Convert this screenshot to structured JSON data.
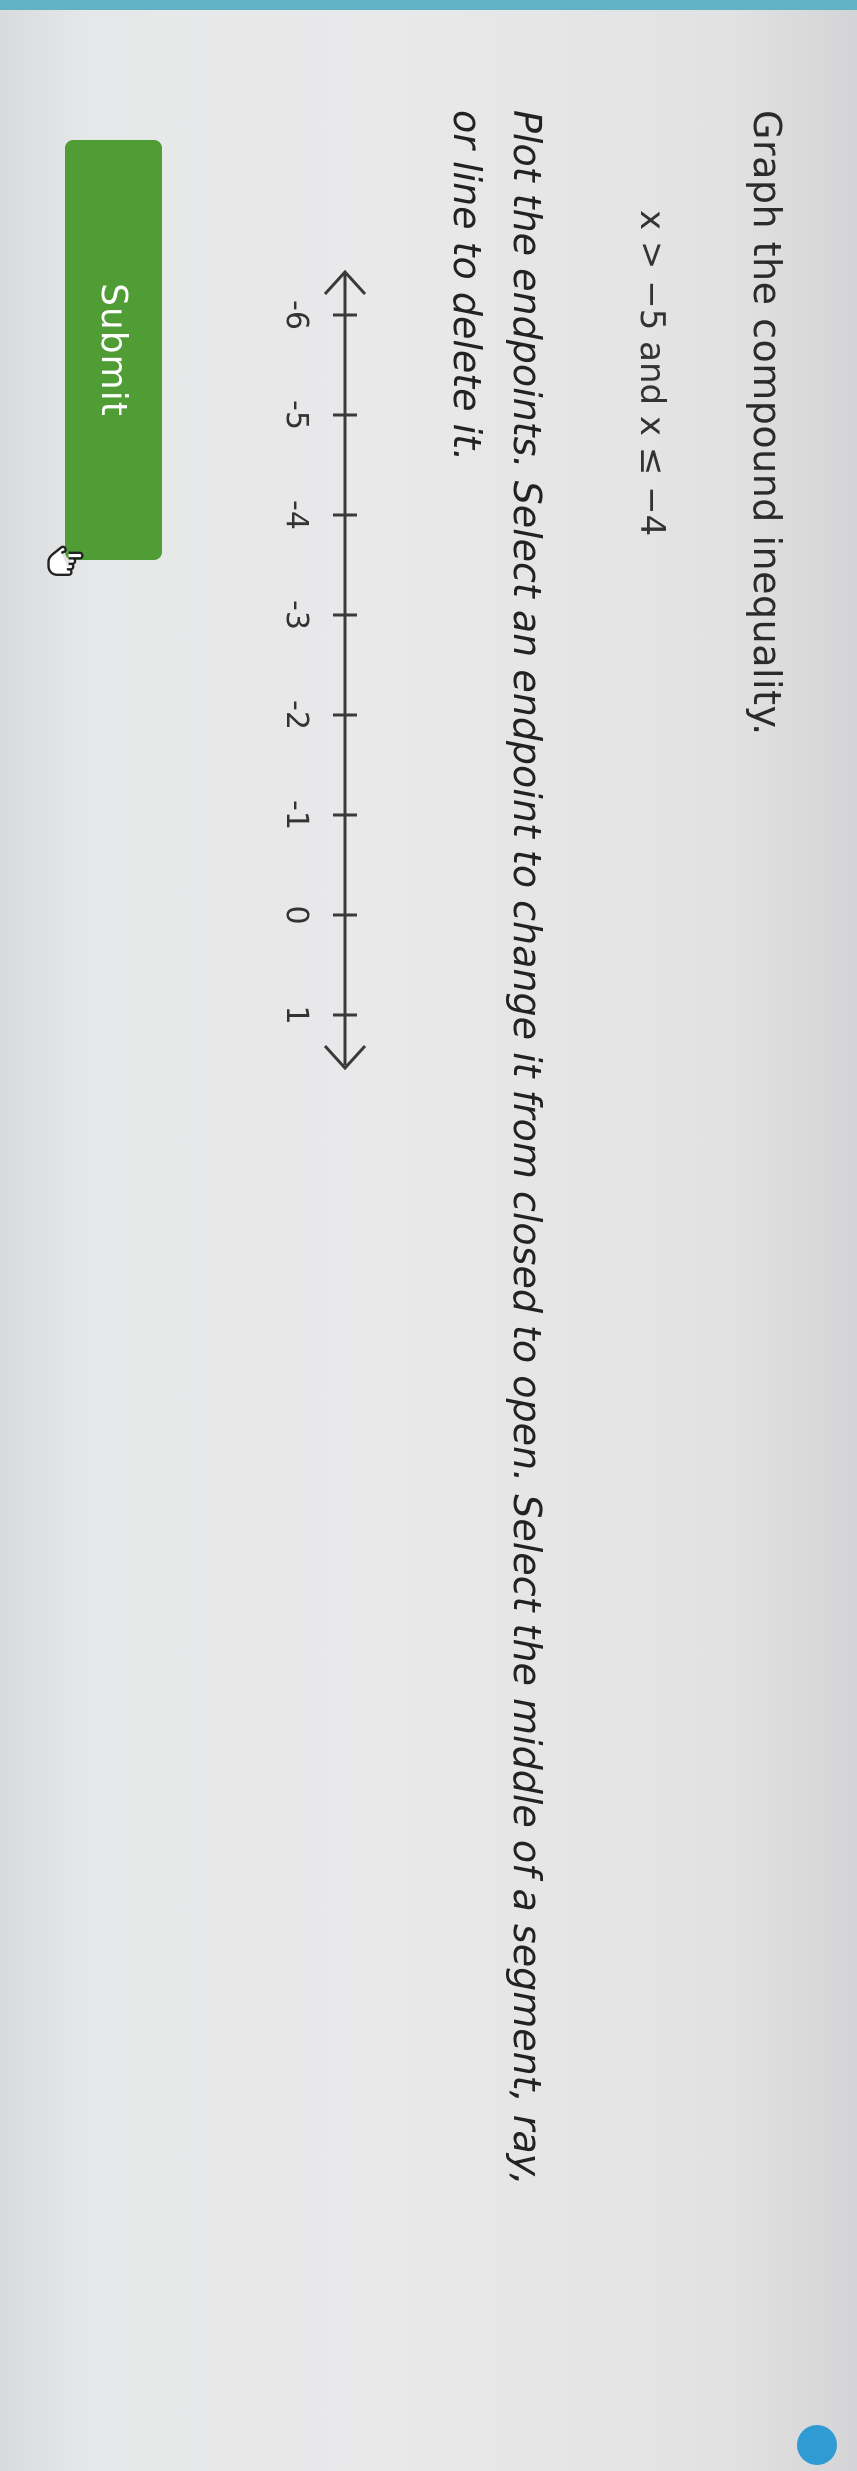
{
  "question": {
    "prompt": "Graph the compound inequality.",
    "inequality": "x > −5 and x ≤ −4",
    "instructions": "Plot the endpoints. Select an endpoint to change it from closed to open. Select the middle of a segment, ray, or line to delete it."
  },
  "number_line": {
    "ticks": [
      "-6",
      "-5",
      "-4",
      "-3",
      "-2",
      "-1",
      "0",
      "1"
    ],
    "left_arrow": "arrow-left-icon",
    "right_arrow": "arrow-right-icon"
  },
  "actions": {
    "submit_label": "Submit"
  },
  "icons": {
    "cursor": "pointer-hand-icon",
    "badge": "help-badge-icon"
  },
  "colors": {
    "submit_bg": "#4f9d34",
    "badge": "#2f9bd2",
    "header_strip": "#5fb3c5"
  }
}
